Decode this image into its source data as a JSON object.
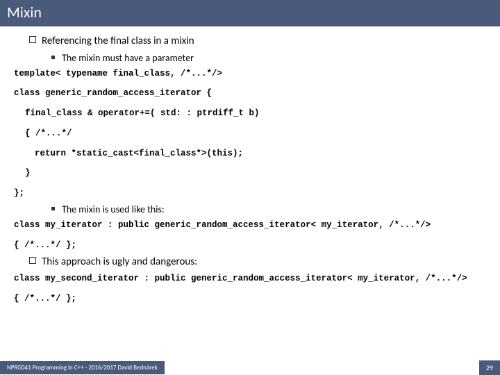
{
  "header": {
    "title": "Mixin"
  },
  "content": {
    "bullets": [
      {
        "text": "Referencing the final class in a mixin",
        "sub": [
          "The mixin must have a parameter",
          "The mixin is used like this:"
        ]
      },
      {
        "text": "This approach is ugly and dangerous:"
      }
    ],
    "code1": [
      "template< typename final_class, /*...*/> ",
      "class generic_random_access_iterator {",
      "final_class & operator+=( std: : ptrdiff_t b)",
      "{ /*...*/",
      "return *static_cast<final_class*>(this);",
      "}",
      "};"
    ],
    "code2": [
      "class my_iterator : public generic_random_access_iterator< my_iterator, /*...*/> ",
      "{ /*...*/ };"
    ],
    "code3": [
      "class my_second_iterator : public generic_random_access_iterator< my_iterator, /*...*/> ",
      "{ /*...*/ };"
    ]
  },
  "footer": {
    "left": "NPRG041 Programming in C++ - 2016/2017 David Bednárek",
    "page": "29"
  }
}
